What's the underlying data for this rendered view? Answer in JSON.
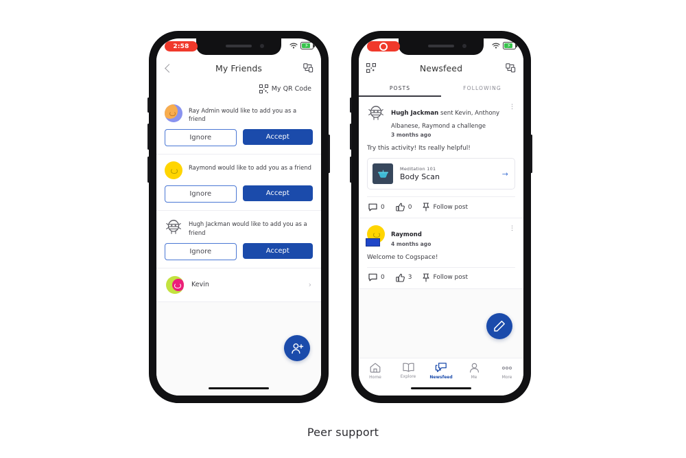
{
  "caption": "Peer support",
  "phone1": {
    "status": {
      "time": "2:58",
      "wifi_icon": "wifi-icon",
      "battery_icon": "battery-charging-icon"
    },
    "header": {
      "back_icon": "chevron-left-icon",
      "title": "My Friends",
      "cast_icon": "screen-share-icon"
    },
    "qr_row": {
      "icon": "qr-code-icon",
      "label": "My QR Code"
    },
    "requests": [
      {
        "avatar": "avatar-ray-admin",
        "text": "Ray Admin would like to add you as a friend",
        "ignore_label": "Ignore",
        "accept_label": "Accept"
      },
      {
        "avatar": "avatar-raymond",
        "text": "Raymond would like to add you as a friend",
        "ignore_label": "Ignore",
        "accept_label": "Accept"
      },
      {
        "avatar": "avatar-hugh-jackman",
        "text": "Hugh Jackman would like to add you as a friend",
        "ignore_label": "Ignore",
        "accept_label": "Accept"
      }
    ],
    "friends": [
      {
        "avatar": "avatar-kevin",
        "name": "Kevin",
        "arrow": "›"
      }
    ],
    "fab": {
      "icon": "add-person-icon"
    }
  },
  "phone2": {
    "status": {
      "recording_icon": "recording-indicator",
      "wifi_icon": "wifi-icon",
      "battery_icon": "battery-charging-icon"
    },
    "header": {
      "scan_icon": "qr-scan-icon",
      "title": "Newsfeed",
      "cast_icon": "screen-share-icon"
    },
    "tabs": [
      {
        "label": "POSTS",
        "active": true
      },
      {
        "label": "FOLLOWING",
        "active": false
      }
    ],
    "posts": [
      {
        "avatar": "avatar-hugh-jackman",
        "author": "Hugh Jackman",
        "action": " sent Kevin, Anthony Albanese, Raymond a challenge",
        "time": "3 months ago",
        "menu_icon": "kebab-menu-icon",
        "body": "Try this activity! Its really helpful!",
        "activity": {
          "thumb_icon": "meditation-bowl-icon",
          "eyebrow": "Meditation 101",
          "title": "Body Scan",
          "arrow_icon": "arrow-right-icon"
        },
        "comments_icon": "comment-icon",
        "comments": "0",
        "likes_icon": "thumbs-up-icon",
        "likes": "0",
        "follow_icon": "pin-icon",
        "follow_label": "Follow post"
      },
      {
        "avatar": "avatar-raymond",
        "author": "Raymond",
        "action": "",
        "time": "4 months ago",
        "menu_icon": "kebab-menu-icon",
        "body": "Welcome to Cogspace!",
        "comments_icon": "comment-icon",
        "comments": "0",
        "likes_icon": "thumbs-up-icon",
        "likes": "3",
        "follow_icon": "pin-icon",
        "follow_label": "Follow post"
      }
    ],
    "fab": {
      "icon": "compose-pencil-icon"
    },
    "bottom_nav": [
      {
        "label": "Home",
        "icon": "home-icon",
        "active": false
      },
      {
        "label": "Explore",
        "icon": "book-icon",
        "active": false
      },
      {
        "label": "Newsfeed",
        "icon": "chat-bubbles-icon",
        "active": true
      },
      {
        "label": "Me",
        "icon": "person-icon",
        "active": false
      },
      {
        "label": "More",
        "icon": "ellipsis-icon",
        "active": false
      }
    ]
  },
  "colors": {
    "accent_blue": "#1b4bab",
    "outline_blue": "#4a77d4",
    "status_red": "#f0392b",
    "battery_green": "#37c24b"
  }
}
